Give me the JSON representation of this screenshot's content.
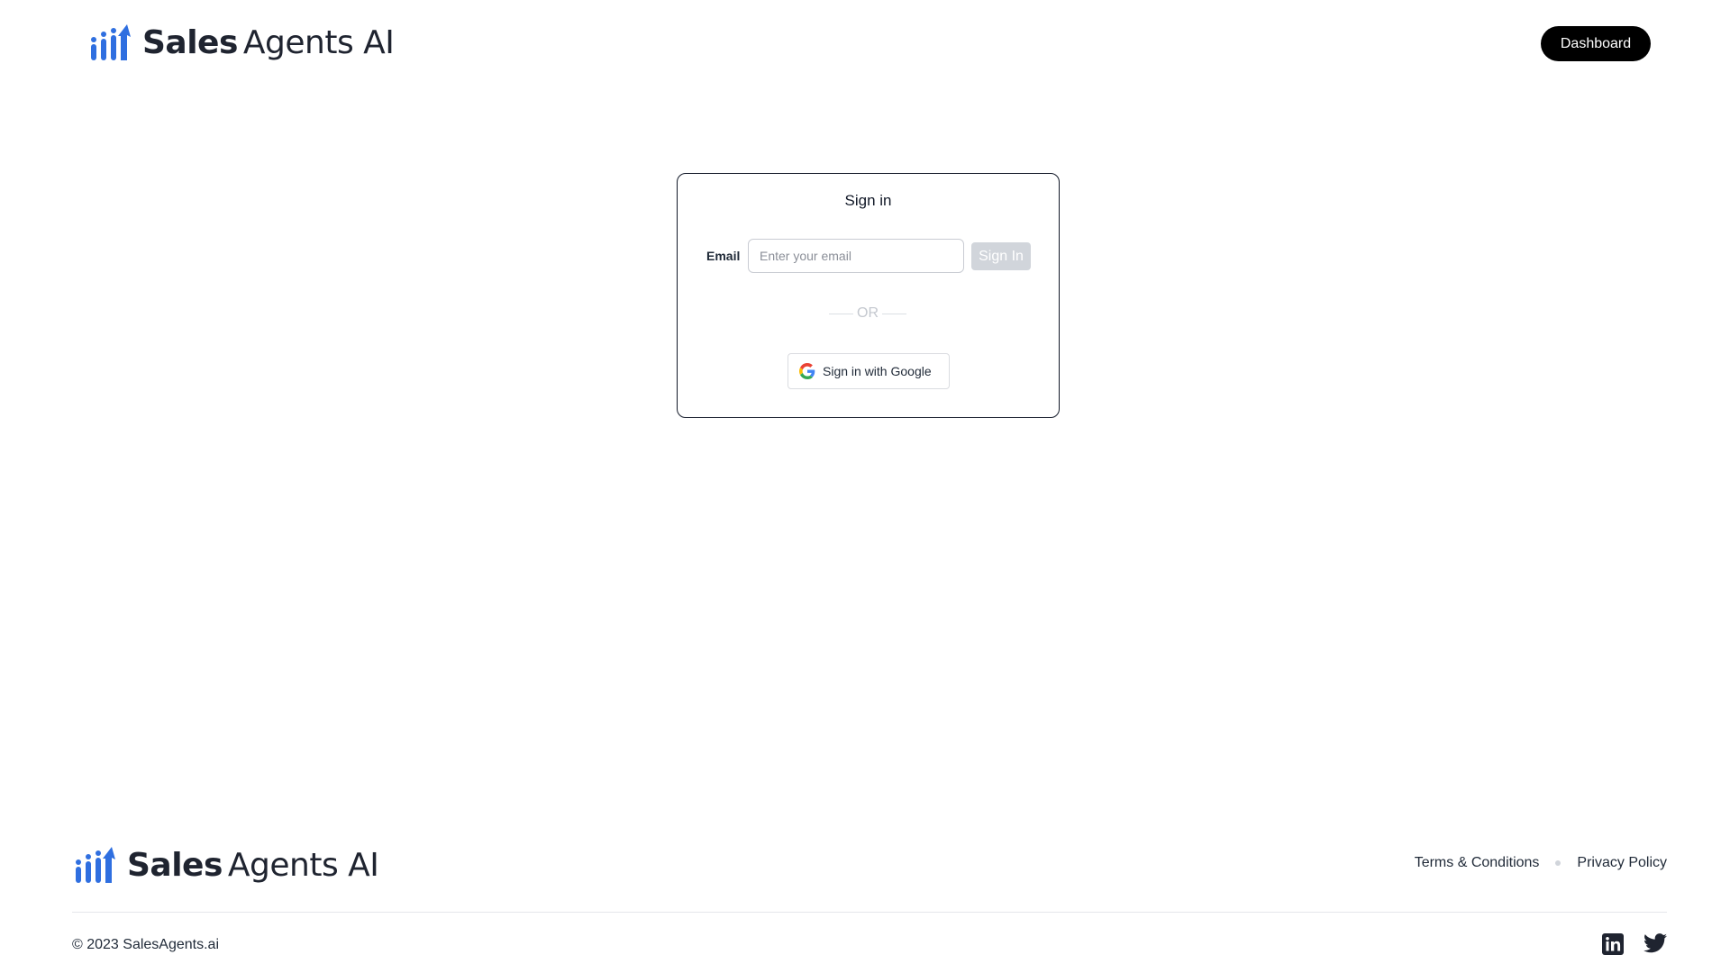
{
  "header": {
    "logo_text_bold": "Sales",
    "logo_text_light": "Agents AI",
    "dashboard_label": "Dashboard"
  },
  "signin_card": {
    "title": "Sign in",
    "email_label": "Email",
    "email_placeholder": "Enter your email",
    "email_value": "",
    "signin_button": "Sign In",
    "or_label": "OR",
    "google_button": "Sign in with Google"
  },
  "footer": {
    "logo_text_bold": "Sales",
    "logo_text_light": "Agents AI",
    "links": [
      "Terms & Conditions",
      "Privacy Policy"
    ],
    "copyright": "© 2023 SalesAgents.ai",
    "social_icons": [
      "linkedin-icon",
      "twitter-icon"
    ]
  },
  "colors": {
    "brand_blue": "#2f6fe0",
    "primary_button": "#000000",
    "disabled_button": "#d1d5db",
    "text": "#1f2937"
  }
}
